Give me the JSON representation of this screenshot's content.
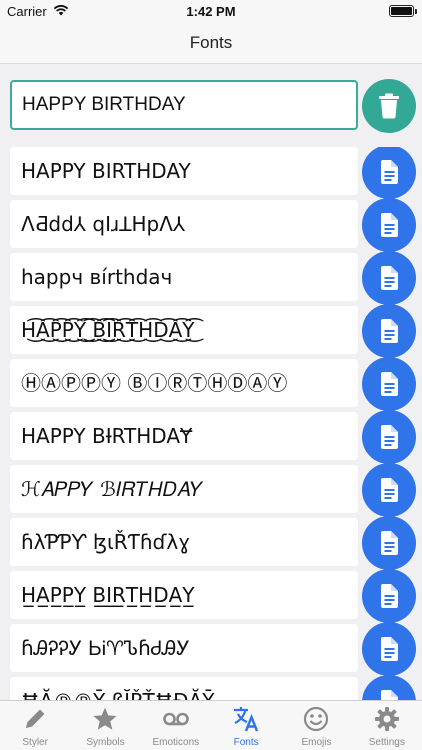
{
  "status_bar": {
    "carrier": "Carrier",
    "time": "1:42 PM",
    "battery_level": 1.0
  },
  "nav": {
    "title": "Fonts"
  },
  "input": {
    "value": "HAPPY BIRTHDAY"
  },
  "icons": {
    "trash": "trash-icon",
    "copy": "document-icon"
  },
  "colors": {
    "accent_green": "#33a896",
    "accent_blue": "#2f74e8",
    "inactive_gray": "#8a8a8a"
  },
  "fonts": [
    {
      "text": "HAPPY BIRTHDAY"
    },
    {
      "text": "ɅƋdd⅄ qIɹꓕHpɅ⅄"
    },
    {
      "text": "hаppч вírthdач"
    },
    {
      "text": "H͜͡A͜͡P͜͡P͜͡Y͜͡ ͜͡B͜͡I͜͡R͜͡T͜͡H͜͡D͜͡A͜͡Y͜͡"
    },
    {
      "text": "ⒽⒶⓅⓅⓎ ⒷⒾⓇⓉⒽⒹⒶⓎ"
    },
    {
      "text": "HAPPY BƗRTHDAɎ"
    },
    {
      "text": "ℋ𝐴𝑃𝑃𝑌 ℬ𝐼𝑅𝑇𝐻𝐷𝐴𝑌"
    },
    {
      "text": "ɦλƤƤƳ ɮιŘƬɦɗλɣ"
    },
    {
      "text": "H̲A̲P̲P̲Y̲ B̲I̲R̲T̲H̲D̲A̲Y̲"
    },
    {
      "text": "ɦᎯᎮᎮᎩ ᏏᎥ♈ᏖɦᏧᎯᎩ"
    },
    {
      "text": "ĦĂ℗℗Ȳ ßĬŘŤĦĐĂȲ"
    }
  ],
  "tabs": [
    {
      "label": "Styler",
      "icon": "pencil-icon",
      "active": false
    },
    {
      "label": "Symbols",
      "icon": "star-icon",
      "active": false
    },
    {
      "label": "Emoticons",
      "icon": "voicemail-icon",
      "active": false
    },
    {
      "label": "Fonts",
      "icon": "translate-icon",
      "active": true
    },
    {
      "label": "Emojis",
      "icon": "smiley-icon",
      "active": false
    },
    {
      "label": "Settings",
      "icon": "gear-icon",
      "active": false
    }
  ]
}
